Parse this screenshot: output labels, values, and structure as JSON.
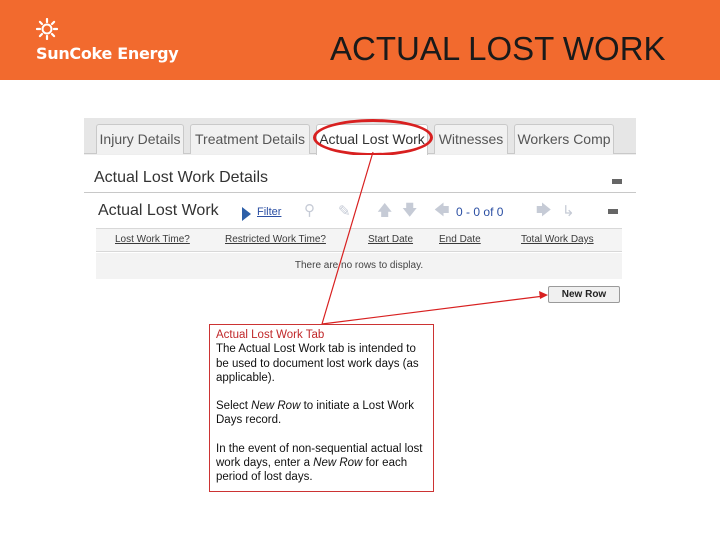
{
  "header": {
    "brand": "SunCoke Energy",
    "title": "ACTUAL LOST WORK"
  },
  "tabs": [
    {
      "label": "Injury Details",
      "active": false
    },
    {
      "label": "Treatment Details",
      "active": false
    },
    {
      "label": "Actual Lost Work",
      "active": true
    },
    {
      "label": "Witnesses",
      "active": false
    },
    {
      "label": "Workers Comp",
      "active": false
    }
  ],
  "panel": {
    "title": "Actual Lost Work Details"
  },
  "grid": {
    "title": "Actual Lost Work",
    "filter_label": "Filter",
    "pager": {
      "from": "0",
      "sep": "-",
      "to": "0",
      "of_label": "of",
      "total": "0"
    },
    "columns": [
      "Lost Work Time?",
      "Restricted Work Time?",
      "Start Date",
      "End Date",
      "Total Work Days"
    ],
    "empty_message": "There are no rows to display.",
    "new_row_label": "New Row"
  },
  "callout": {
    "heading": "Actual Lost Work Tab",
    "intro": "The Actual Lost Work tab is intended to be used to document lost work days (as applicable).",
    "select_before": "Select ",
    "select_em": "New Row",
    "select_after": " to initiate a Lost Work Days record.",
    "event_before": "In the event of non-sequential actual lost work days, enter a ",
    "event_em": "New Row",
    "event_after": " for each period of lost days."
  },
  "colors": {
    "banner": "#f26a2e",
    "highlight": "#d82020",
    "link": "#2b4fa3"
  }
}
